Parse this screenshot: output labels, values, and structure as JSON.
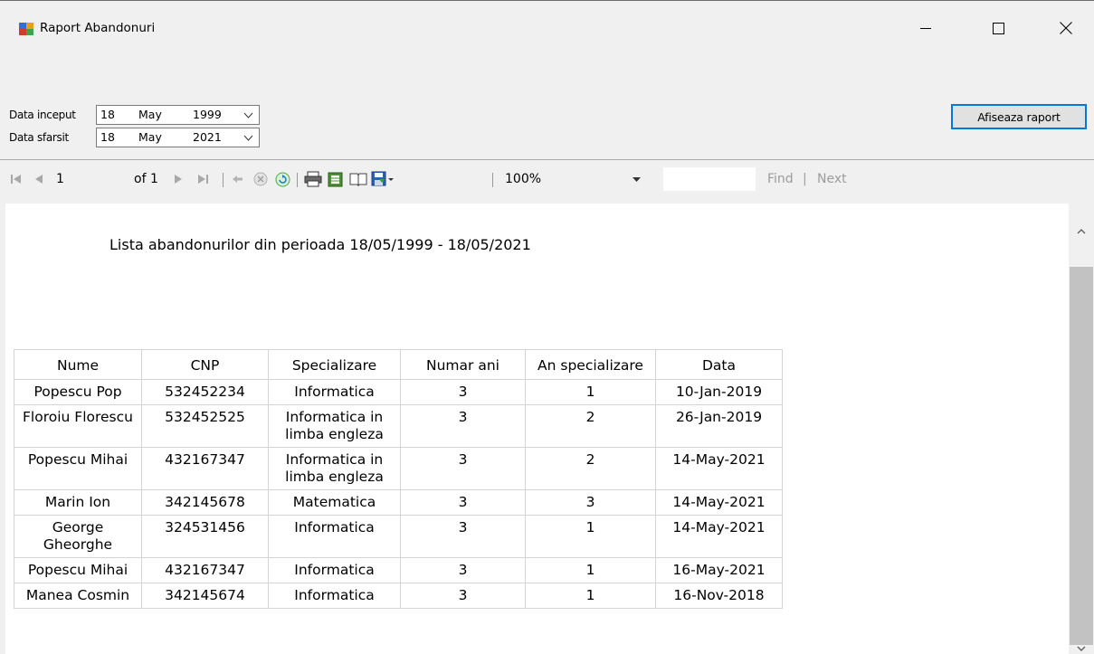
{
  "window": {
    "title": "Raport Abandonuri"
  },
  "filters": {
    "start_label": "Data inceput",
    "end_label": "Data sfarsit",
    "start": {
      "day": "18",
      "month": "May",
      "year": "1999"
    },
    "end": {
      "day": "18",
      "month": "May",
      "year": "2021"
    },
    "show_button": "Afiseaza raport"
  },
  "toolbar": {
    "page_current": "1",
    "page_of": "of 1",
    "zoom": "100%",
    "find": "Find",
    "find_sep": "|",
    "next": "Next"
  },
  "report": {
    "title": "Lista abandonurilor din perioada 18/05/1999 - 18/05/2021",
    "columns": [
      "Nume",
      "CNP",
      "Specializare",
      "Numar ani",
      "An specializare",
      "Data"
    ],
    "rows": [
      [
        "Popescu Pop",
        "532452234",
        "Informatica",
        "3",
        "1",
        "10-Jan-2019"
      ],
      [
        "Floroiu Florescu",
        "532452525",
        "Informatica in limba engleza",
        "3",
        "2",
        "26-Jan-2019"
      ],
      [
        "Popescu Mihai",
        "432167347",
        "Informatica in limba engleza",
        "3",
        "2",
        "14-May-2021"
      ],
      [
        "Marin Ion",
        "342145678",
        "Matematica",
        "3",
        "3",
        "14-May-2021"
      ],
      [
        "George Gheorghe",
        "324531456",
        "Informatica",
        "3",
        "1",
        "14-May-2021"
      ],
      [
        "Popescu Mihai",
        "432167347",
        "Informatica",
        "3",
        "1",
        "16-May-2021"
      ],
      [
        "Manea Cosmin",
        "342145674",
        "Informatica",
        "3",
        "1",
        "16-Nov-2018"
      ]
    ]
  }
}
